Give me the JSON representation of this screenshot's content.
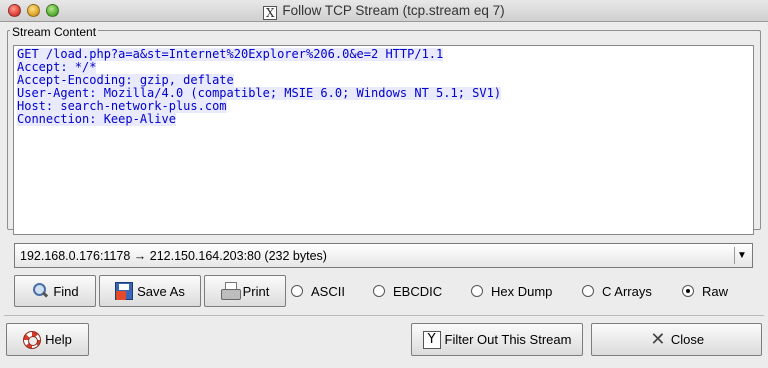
{
  "window": {
    "title": "Follow TCP Stream (tcp.stream eq 7)",
    "icon": "x-app-icon"
  },
  "group": {
    "label": "Stream Content"
  },
  "stream_lines": [
    "GET /load.php?a=a&st=Internet%20Explorer%206.0&e=2 HTTP/1.1",
    "Accept: */*",
    "Accept-Encoding: gzip, deflate",
    "User-Agent: Mozilla/4.0 (compatible; MSIE 6.0; Windows NT 5.1; SV1)",
    "Host: search-network-plus.com",
    "Connection: Keep-Alive"
  ],
  "conversation": {
    "selected": "192.168.0.176:1178 → 212.150.164.203:80 (232 bytes)"
  },
  "buttons": {
    "find": "Find",
    "save_as": "Save As",
    "print": "Print",
    "help": "Help",
    "filter_out": "Filter Out This Stream",
    "close": "Close"
  },
  "formats": {
    "options": [
      "ASCII",
      "EBCDIC",
      "Hex Dump",
      "C Arrays",
      "Raw"
    ],
    "selected": "Raw"
  },
  "colors": {
    "stream_text": "#0000cc",
    "stream_highlight": "#eaeaff"
  }
}
